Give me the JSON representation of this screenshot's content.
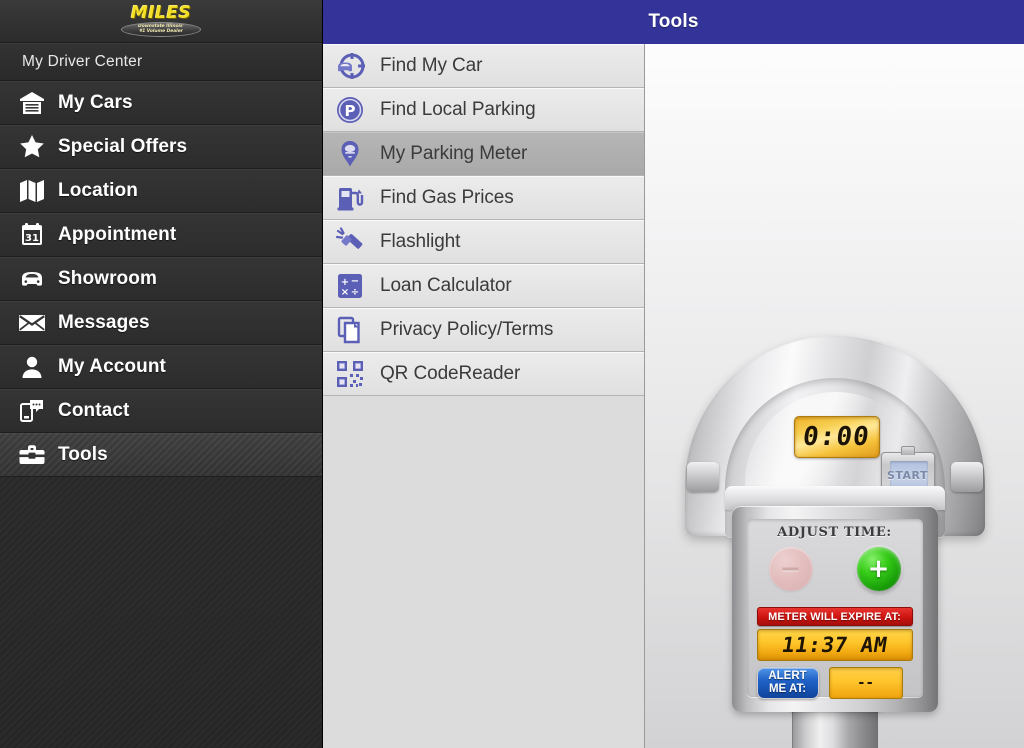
{
  "brand": {
    "logo_main": "MILES",
    "logo_sub_line1": "Downstate Illinois'",
    "logo_sub_line2": "#1 Volume Dealer"
  },
  "sidebar": {
    "section_title": "My Driver Center",
    "active_item": "Tools",
    "items": [
      {
        "label": "My Cars",
        "icon": "garage-icon"
      },
      {
        "label": "Special Offers",
        "icon": "star-icon"
      },
      {
        "label": "Location",
        "icon": "map-icon"
      },
      {
        "label": "Appointment",
        "icon": "calendar-icon"
      },
      {
        "label": "Showroom",
        "icon": "car-icon"
      },
      {
        "label": "Messages",
        "icon": "envelope-icon"
      },
      {
        "label": "My Account",
        "icon": "person-icon"
      },
      {
        "label": "Contact",
        "icon": "phone-chat-icon"
      },
      {
        "label": "Tools",
        "icon": "toolbox-icon"
      }
    ]
  },
  "header": {
    "title": "Tools"
  },
  "tools": {
    "selected": "My Parking Meter",
    "items": [
      {
        "label": "Find My Car",
        "icon": "car-locate-icon"
      },
      {
        "label": "Find Local Parking",
        "icon": "parking-p-icon"
      },
      {
        "label": "My Parking Meter",
        "icon": "parking-meter-icon"
      },
      {
        "label": "Find Gas Prices",
        "icon": "gas-pump-icon"
      },
      {
        "label": "Flashlight",
        "icon": "flashlight-icon"
      },
      {
        "label": "Loan Calculator",
        "icon": "calculator-icon"
      },
      {
        "label": "Privacy Policy/Terms",
        "icon": "documents-icon"
      },
      {
        "label": "QR CodeReader",
        "icon": "qr-code-icon"
      }
    ]
  },
  "meter": {
    "countdown_display": "0:00",
    "start_button_label": "START",
    "adjust_time_label": "ADJUST TIME:",
    "decrease_glyph": "−",
    "increase_glyph": "+",
    "expire_banner_label": "METER WILL EXPIRE AT:",
    "expire_time": "11:37 AM",
    "alert_button_line1": "ALERT",
    "alert_button_line2": "ME AT:",
    "alert_value": "--"
  },
  "colors": {
    "header_blue": "#333399",
    "sidebar_dark": "#2f2f2f",
    "tool_icon_purple": "#5b5fb5",
    "expire_red": "#cc1410",
    "lcd_amber": "#ffc62c",
    "plus_green": "#36cc18",
    "alert_blue": "#1f62c6",
    "logo_yellow": "#f5e028"
  }
}
